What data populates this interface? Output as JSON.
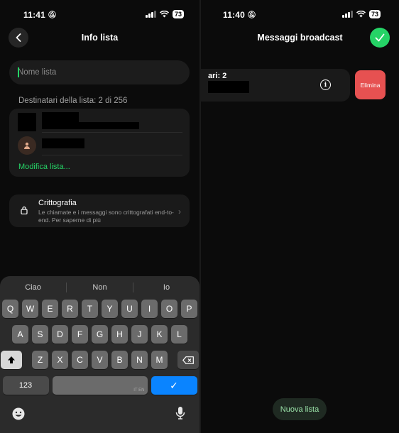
{
  "left_screen": {
    "status": {
      "time": "11:41",
      "battery": "73"
    },
    "header": {
      "title": "Info lista"
    },
    "name_field": {
      "placeholder": "Nome lista"
    },
    "recipients": {
      "label": "Destinatari della lista: 2 di 256",
      "edit_link": "Modifica lista..."
    },
    "encryption": {
      "title": "Crittografia",
      "description": "Le chiamate e i messaggi sono crittografati end-to-end. Per saperne di più"
    },
    "keyboard": {
      "suggestions": [
        "Ciao",
        "Non",
        "Io"
      ],
      "row1": [
        "Q",
        "W",
        "E",
        "R",
        "T",
        "Y",
        "U",
        "I",
        "O",
        "P"
      ],
      "row2": [
        "A",
        "S",
        "D",
        "F",
        "G",
        "H",
        "J",
        "K",
        "L"
      ],
      "row3": [
        "Z",
        "X",
        "C",
        "V",
        "B",
        "N",
        "M"
      ],
      "numbers_key": "123",
      "space_lang": "IT EN",
      "return_symbol": "✓"
    }
  },
  "right_screen": {
    "status": {
      "time": "11:40",
      "battery": "73"
    },
    "header": {
      "title": "Messaggi broadcast"
    },
    "list_item": {
      "text": "ari: 2"
    },
    "delete_label": "Elimina",
    "new_list_label": "Nuova lista"
  }
}
